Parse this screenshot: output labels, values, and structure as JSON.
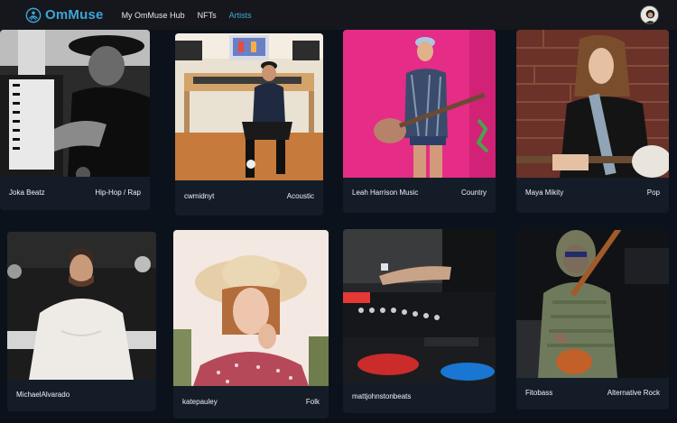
{
  "brand": {
    "name": "OmMuse"
  },
  "nav": {
    "items": [
      {
        "label": "My OmMuse Hub"
      },
      {
        "label": "NFTs"
      },
      {
        "label": "Artists"
      }
    ]
  },
  "colors": {
    "accent": "#44a7d9",
    "background": "#0b121c",
    "card": "#141c28",
    "navbar": "#15171c"
  },
  "artists": [
    {
      "name": "Joka Beatz",
      "genre": "Hip-Hop / Rap"
    },
    {
      "name": "cwmidnyt",
      "genre": "Acoustic"
    },
    {
      "name": "Leah Harrison Music",
      "genre": "Country"
    },
    {
      "name": "Maya Mikity",
      "genre": "Pop"
    },
    {
      "name": "MichaelAlvarado",
      "genre": ""
    },
    {
      "name": "katepauley",
      "genre": "Folk"
    },
    {
      "name": "mattjohnstonbeats",
      "genre": ""
    },
    {
      "name": "Fitobass",
      "genre": "Alternative Rock"
    }
  ]
}
